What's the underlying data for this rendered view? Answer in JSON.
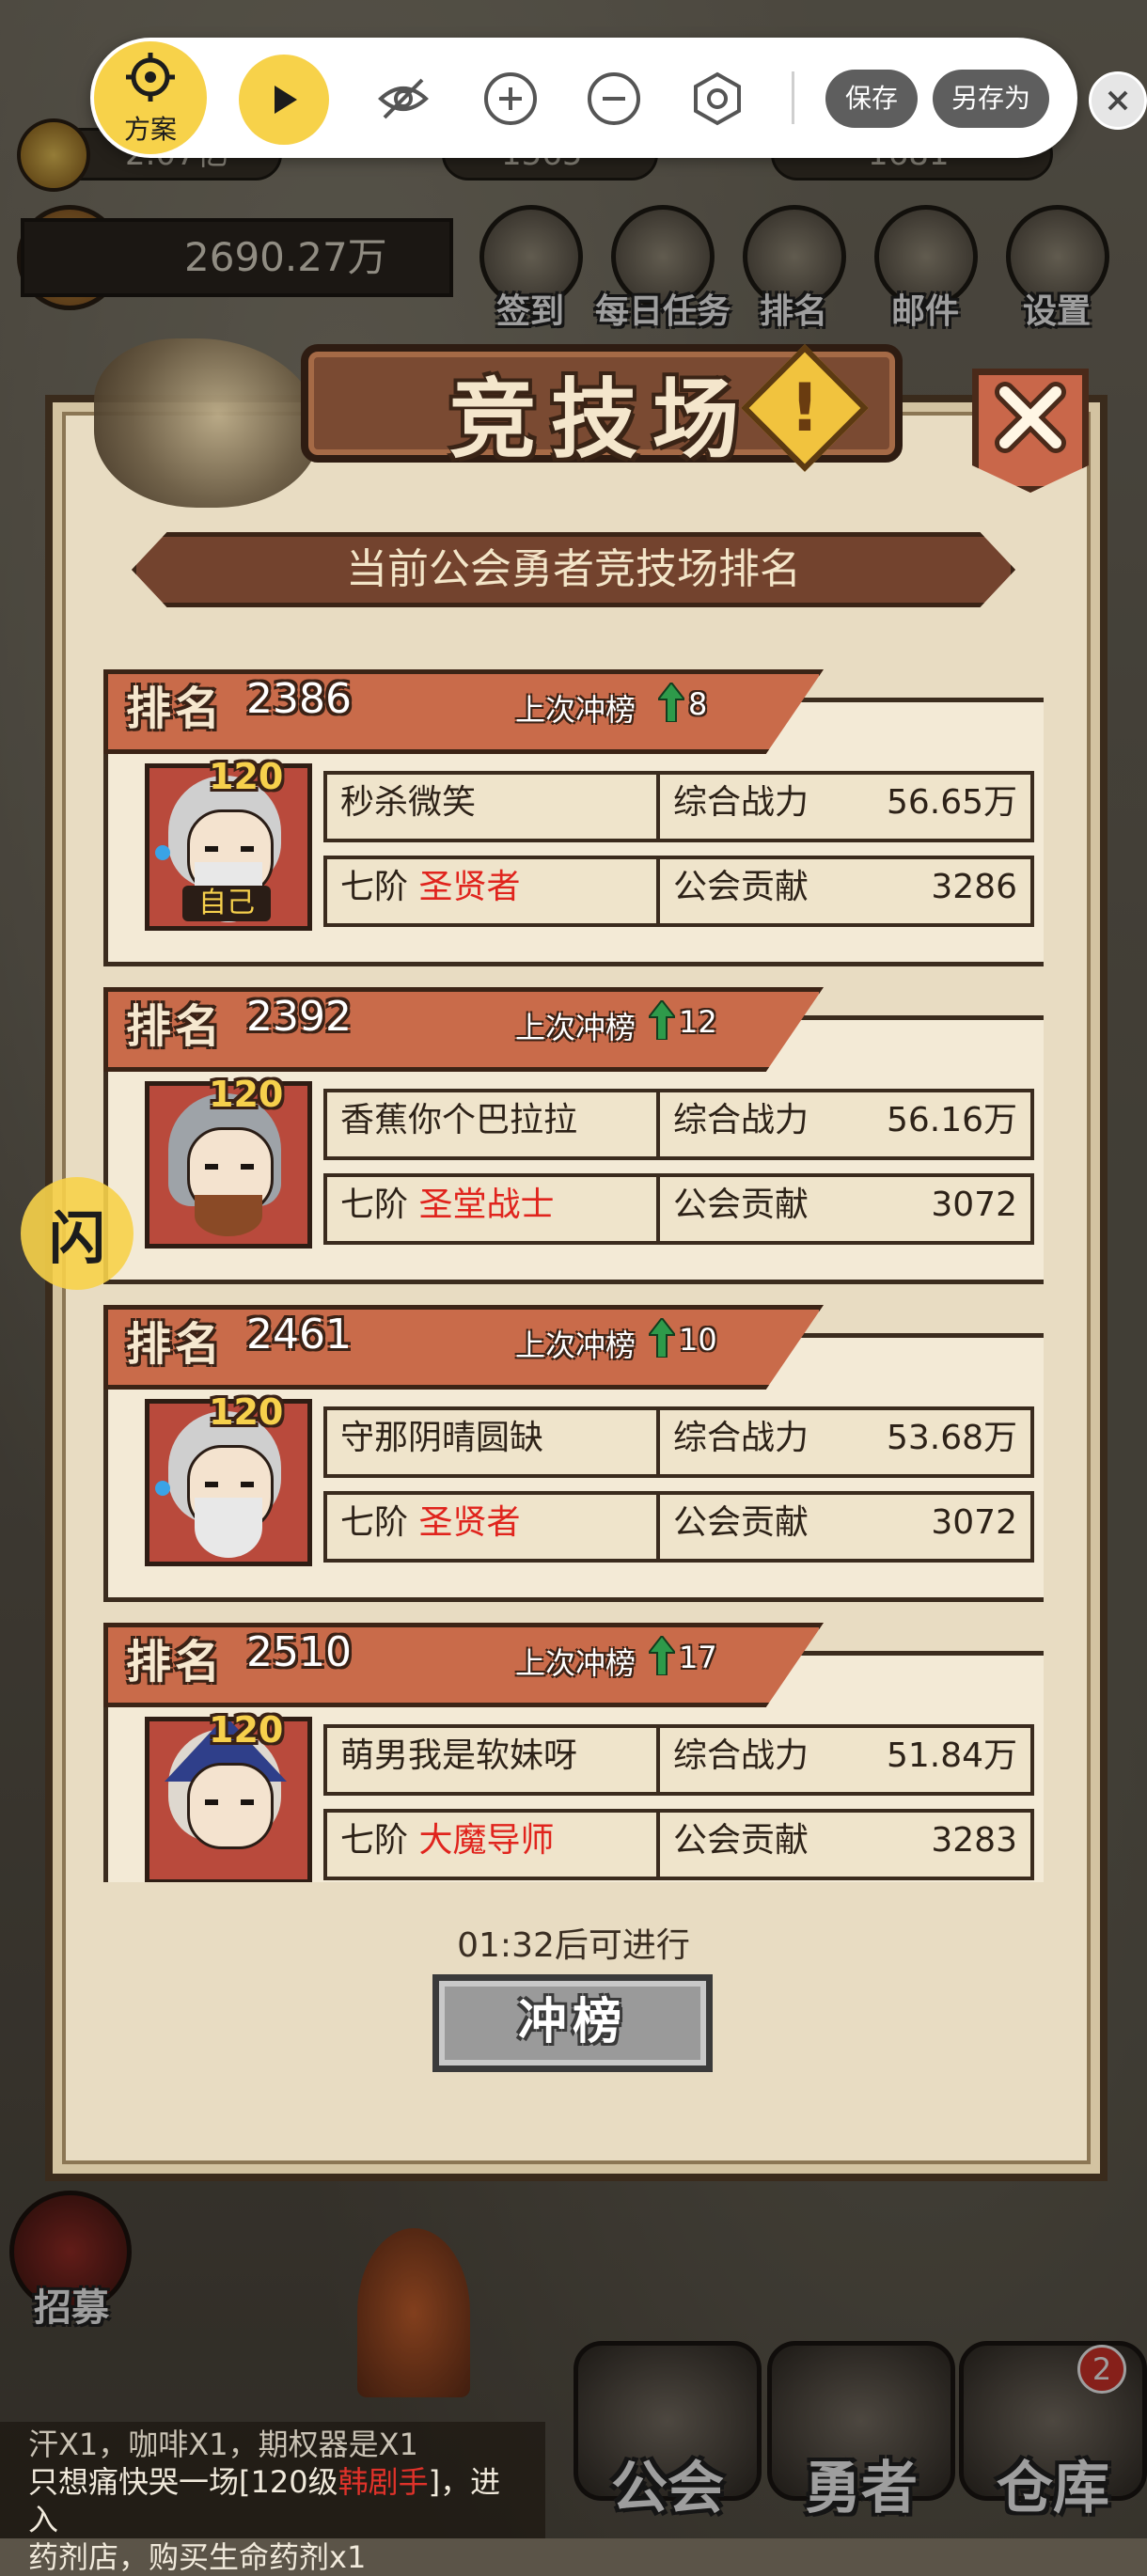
{
  "hud": {
    "gold": "2.07亿",
    "res2": "1565",
    "res3": "1681",
    "power": "2690.27万",
    "icons": [
      {
        "label": "签到",
        "icon": "checkin-icon"
      },
      {
        "label": "每日任务",
        "icon": "daily-task-icon"
      },
      {
        "label": "排名",
        "icon": "ranking-icon"
      },
      {
        "label": "邮件",
        "icon": "mail-icon"
      },
      {
        "label": "设置",
        "icon": "settings-icon"
      }
    ]
  },
  "toolbar": {
    "plan_label": "方案",
    "save_label": "保存",
    "save_as_label": "另存为"
  },
  "panel": {
    "title": "竞技场",
    "subtitle": "当前公会勇者竞技场排名",
    "rank_label": "排名",
    "prev_label": "上次冲榜",
    "power_label": "综合战力",
    "contrib_label": "公会贡献",
    "tier": "七阶",
    "self_tag": "自己",
    "timer": "01:32后可进行",
    "button": "冲榜"
  },
  "players": [
    {
      "rank": "2386",
      "prev": "8",
      "name": "秒杀微笑",
      "class": "圣贤者",
      "level": "120",
      "power": "56.65万",
      "contrib": "3286"
    },
    {
      "rank": "2392",
      "prev": "12",
      "name": "香蕉你个巴拉拉",
      "class": "圣堂战士",
      "level": "120",
      "power": "56.16万",
      "contrib": "3072"
    },
    {
      "rank": "2461",
      "prev": "10",
      "name": "守那阴晴圆缺",
      "class": "圣贤者",
      "level": "120",
      "power": "53.68万",
      "contrib": "3072"
    },
    {
      "rank": "2510",
      "prev": "17",
      "name": "萌男我是软妹呀",
      "class": "大魔导师",
      "level": "120",
      "power": "51.84万",
      "contrib": "3283"
    }
  ],
  "side_button": "闪",
  "recruit_label": "招募",
  "nav": {
    "guild": "公会",
    "hero": "勇者",
    "warehouse": "仓库",
    "warehouse_badge": "2"
  },
  "chat": {
    "line1": "汗X1，咖啡X1，期权器是X1",
    "line2_a": "只想痛快哭一场[120级",
    "line2_red": "韩剧手",
    "line2_b": "]，进入",
    "line3": "药剂店，购买生命药剂x1"
  },
  "colors": {
    "accent_yellow": "#f7d24a",
    "class_red": "#e0241d",
    "ribbon": "#c96b4a",
    "arrow_green": "#2e9a4a"
  }
}
